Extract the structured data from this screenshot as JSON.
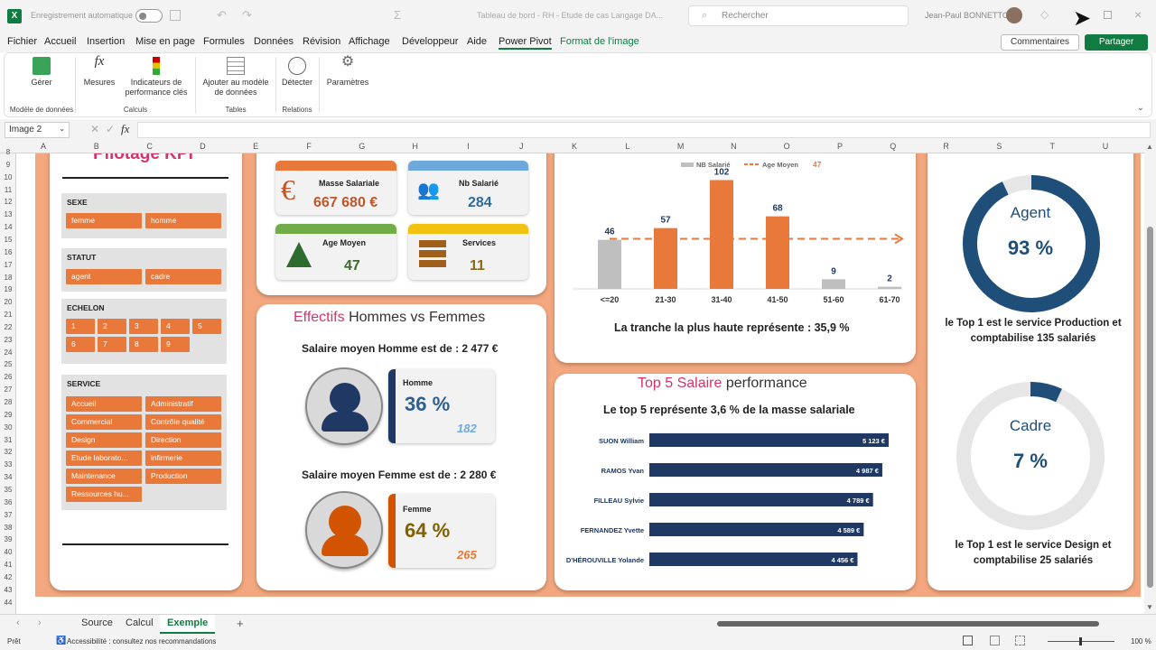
{
  "titlebar": {
    "autosave": "Enregistrement automatique",
    "doc_title": "Tableau de bord - RH - Etude de cas Langage DA...",
    "search_placeholder": "Rechercher",
    "user": "Jean-Paul BONNETTO"
  },
  "menu": [
    "Fichier",
    "Accueil",
    "Insertion",
    "Mise en page",
    "Formules",
    "Données",
    "Révision",
    "Affichage",
    "Développeur",
    "Aide",
    "Power Pivot",
    "Format de l'image"
  ],
  "comments_label": "Commentaires",
  "share_label": "Partager",
  "ribbon": {
    "buttons": [
      {
        "label": "Gérer"
      },
      {
        "label": "Mesures"
      },
      {
        "label": "Indicateurs de performance clés"
      },
      {
        "label": "Ajouter au modèle de données"
      },
      {
        "label": "Détecter"
      },
      {
        "label": "Paramètres"
      }
    ],
    "groups": [
      "Modèle de données",
      "Calculs",
      "Tables",
      "Relations"
    ]
  },
  "namebox": "Image 2",
  "columns": [
    "A",
    "B",
    "C",
    "D",
    "E",
    "F",
    "G",
    "H",
    "I",
    "J",
    "K",
    "L",
    "M",
    "N",
    "O",
    "P",
    "Q",
    "R",
    "S",
    "T",
    "U"
  ],
  "rows": [
    "8",
    "9",
    "10",
    "11",
    "12",
    "13",
    "14",
    "15",
    "16",
    "17",
    "18",
    "19",
    "20",
    "21",
    "22",
    "23",
    "24",
    "25",
    "26",
    "27",
    "28",
    "29",
    "30",
    "31",
    "32",
    "33",
    "34",
    "35",
    "36",
    "37",
    "38",
    "39",
    "40",
    "41",
    "42",
    "43",
    "44"
  ],
  "dashboard": {
    "pilotage_title": "Pilotage KPI",
    "slicers": {
      "sexe": {
        "title": "SEXE",
        "items": [
          "femme",
          "homme"
        ]
      },
      "statut": {
        "title": "STATUT",
        "items": [
          "agent",
          "cadre"
        ]
      },
      "echelon": {
        "title": "ECHELON",
        "items": [
          "1",
          "2",
          "3",
          "4",
          "5",
          "6",
          "7",
          "8",
          "9"
        ]
      },
      "service": {
        "title": "SERVICE",
        "items": [
          "Accueil",
          "Administratif",
          "Commercial",
          "Contrôle qualité",
          "Design",
          "Direction",
          "Etude laborato...",
          "infirmerie",
          "Maintenance",
          "Production",
          "Ressources hu..."
        ]
      }
    },
    "kpis": {
      "masse": {
        "label": "Masse Salariale",
        "value": "667 680 €",
        "color": "#e8793a"
      },
      "nb": {
        "label": "Nb Salarié",
        "value": "284",
        "color": "#6fa8dc"
      },
      "age": {
        "label": "Age Moyen",
        "value": "47",
        "color": "#70ad47"
      },
      "services": {
        "label": "Services",
        "value": "11",
        "color": "#f2c211"
      }
    },
    "effectifs": {
      "title_a": "Effectifs",
      "title_b": " Hommes vs Femmes",
      "homme_salaire": "Salaire moyen Homme est de : 2 477 €",
      "homme_label": "Homme",
      "homme_pct": "36 %",
      "homme_nb": "182",
      "femme_salaire": "Salaire moyen Femme est de : 2 280 €",
      "femme_label": "Femme",
      "femme_pct": "64 %",
      "femme_nb": "265"
    },
    "age_chart": {
      "legend_nb": "NB Salarié",
      "legend_age": "Age Moyen",
      "legend_age_value": "47",
      "caption": "La tranche la plus haute représente : 35,9 %"
    },
    "top5": {
      "title_a": "Top 5 Salaire",
      "title_b": " performance",
      "caption": "Le top 5 représente 3,6 % de la masse salariale"
    },
    "statut_perf": {
      "agent_label": "Agent",
      "agent_pct": "93 %",
      "agent_value": 0.93,
      "agent_caption": "le Top 1 est le service Production et comptabilise 135 salariés",
      "cadre_label": "Cadre",
      "cadre_pct": "7 %",
      "cadre_value": 0.07,
      "cadre_caption": "le Top 1 est le service Design et comptabilise 25 salariés"
    }
  },
  "chart_data": [
    {
      "type": "bar",
      "categories": [
        "<=20",
        "21-30",
        "31-40",
        "41-50",
        "51-60",
        "61-70"
      ],
      "series": [
        {
          "name": "NB Salarié",
          "values": [
            46,
            57,
            102,
            68,
            9,
            2
          ]
        },
        {
          "name": "Age Moyen",
          "values": [
            47,
            47,
            47,
            47,
            47,
            47
          ]
        }
      ],
      "ylim": [
        0,
        110
      ],
      "legend": "top"
    },
    {
      "type": "bar",
      "orientation": "horizontal",
      "categories": [
        "SUON William",
        "RAMOS Yvan",
        "FILLEAU Sylvie",
        "FERNANDEZ Yvette",
        "D'HÉROUVILLE Yolande"
      ],
      "values": [
        5123,
        4987,
        4789,
        4589,
        4456
      ],
      "labels": [
        "5 123 €",
        "4 987 €",
        "4 789 €",
        "4 589 €",
        "4 456 €"
      ],
      "xlim": [
        0,
        5800
      ]
    }
  ],
  "sheet_tabs": [
    "Source",
    "Calcul",
    "Exemple"
  ],
  "active_tab": "Exemple",
  "status": {
    "ready": "Prêt",
    "accessibility": "Accessibilité : consultez nos recommandations",
    "zoom": "100 %"
  }
}
